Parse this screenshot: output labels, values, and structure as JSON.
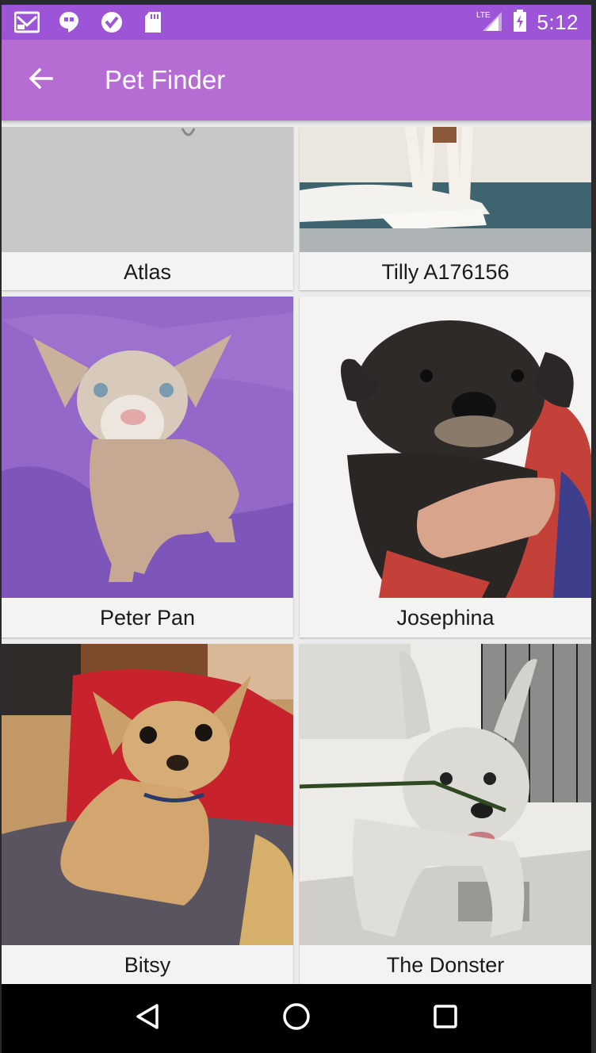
{
  "status_bar": {
    "time": "5:12",
    "network": "LTE",
    "icons": [
      "gmail-icon",
      "hangouts-icon",
      "check-icon",
      "sd-card-icon",
      "signal-icon",
      "battery-icon"
    ]
  },
  "app_bar": {
    "title": "Pet Finder",
    "back_icon": "arrow-back-icon"
  },
  "pets": [
    {
      "name": "Atlas"
    },
    {
      "name": "Tilly A176156"
    },
    {
      "name": "Peter Pan"
    },
    {
      "name": "Josephina"
    },
    {
      "name": "Bitsy"
    },
    {
      "name": "The Donster"
    }
  ],
  "nav_bar": {
    "back": "nav-back-icon",
    "home": "nav-home-icon",
    "recents": "nav-recents-icon"
  },
  "colors": {
    "status_bar": "#9b55d6",
    "app_bar": "#b56cd3"
  }
}
